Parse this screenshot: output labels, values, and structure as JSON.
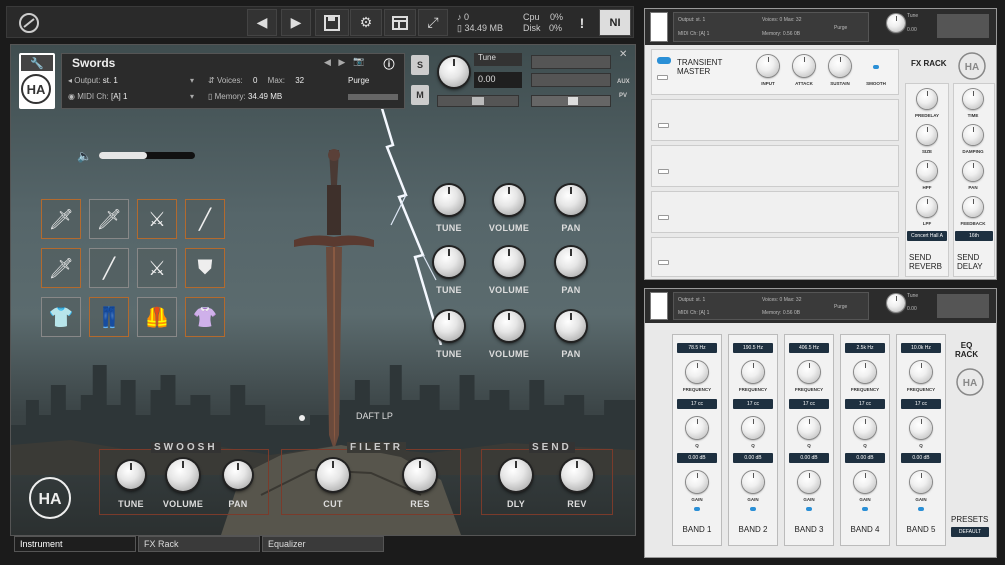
{
  "topbar": {
    "cpu_label": "Cpu",
    "cpu_val": "0%",
    "disk_label": "Disk",
    "disk_val": "0%",
    "voices": "0",
    "memory": "34.49 MB",
    "ni": "NI"
  },
  "instrument": {
    "name": "Swords",
    "output_label": "Output:",
    "output": "st. 1",
    "voices_label": "Voices:",
    "voices": "0",
    "max_label": "Max:",
    "max": "32",
    "purge": "Purge",
    "midi_label": "MIDI Ch:",
    "midi": "[A] 1",
    "memory_label": "Memory:",
    "memory": "34.49 MB",
    "tune_label": "Tune",
    "tune_val": "0.00",
    "s": "S",
    "m": "M",
    "aux": "AUX",
    "pv": "PV",
    "draft": "DAFT LP",
    "knob_rows": [
      {
        "tune": "TUNE",
        "volume": "VOLUME",
        "pan": "PAN"
      },
      {
        "tune": "TUNE",
        "volume": "VOLUME",
        "pan": "PAN"
      },
      {
        "tune": "TUNE",
        "volume": "VOLUME",
        "pan": "PAN"
      }
    ],
    "swoosh": {
      "title": "SWOOSH",
      "tune": "TUNE",
      "volume": "VOLUME",
      "pan": "PAN"
    },
    "filter": {
      "title": "FILETR",
      "cut": "CUT",
      "res": "RES"
    },
    "send": {
      "title": "SEND",
      "dly": "DLY",
      "rev": "REV"
    }
  },
  "tabs": [
    "Instrument",
    "FX Rack",
    "Equalizer"
  ],
  "fx": {
    "mini_output": "Output:",
    "mini_st": "st. 1",
    "mini_voices": "Voices:",
    "mini_max": "Max:",
    "mini_maxval": "32",
    "mini_midi": "MIDI Ch:",
    "mini_midival": "[A] 1",
    "mini_mem": "Memory:",
    "mini_memval": "0.56 0B",
    "mini_purge": "Purge",
    "mini_tune": "Tune",
    "mini_tuneval": "0.00",
    "mini_voicesval": "0",
    "transient_title_1": "TRANSIENT",
    "transient_title_2": "MASTER",
    "input": "INPUT",
    "attack": "ATTACK",
    "sustain": "SUSTAIN",
    "smooth": "SMOOTH",
    "rack_title": "FX RACK",
    "predelay": "PREDELAY",
    "size": "SIZE",
    "hpf": "HPF",
    "lpf": "LPF",
    "reverb_preset": "Concert Hall A",
    "send_reverb_1": "SEND",
    "send_reverb_2": "REVERB",
    "time": "TIME",
    "damping": "DAMPING",
    "pan": "PAN",
    "feedback": "FEEDBACK",
    "delay_preset": "16th",
    "send_delay_1": "SEND",
    "send_delay_2": "DELAY"
  },
  "eq": {
    "mini_output": "Output:",
    "mini_st": "st. 1",
    "mini_voices": "Voices:",
    "mini_voicesval": "0",
    "mini_max": "Max:",
    "mini_maxval": "32",
    "mini_midi": "MIDI Ch:",
    "mini_midival": "[A] 1",
    "mini_mem": "Memory:",
    "mini_memval": "0.56 0B",
    "mini_purge": "Purge",
    "mini_tune": "Tune",
    "mini_tuneval": "0.00",
    "title_1": "EQ",
    "title_2": "RACK",
    "presets": "PRESETS",
    "default": "DEFAULT",
    "bands": [
      {
        "freq": "78.5 Hz",
        "q": "17 cc",
        "gain": "0.00 dB",
        "label": "BAND 1"
      },
      {
        "freq": "190.5 Hz",
        "q": "17 cc",
        "gain": "0.00 dB",
        "label": "BAND 2"
      },
      {
        "freq": "406.5 Hz",
        "q": "17 cc",
        "gain": "0.00 dB",
        "label": "BAND 3"
      },
      {
        "freq": "2.5k Hz",
        "q": "17 cc",
        "gain": "0.00 dB",
        "label": "BAND 4"
      },
      {
        "freq": "10.0k Hz",
        "q": "17 cc",
        "gain": "0.00 dB",
        "label": "BAND 5"
      }
    ],
    "frequency": "FREQUENCY",
    "q_label": "Q",
    "gain_label": "GAIN"
  }
}
